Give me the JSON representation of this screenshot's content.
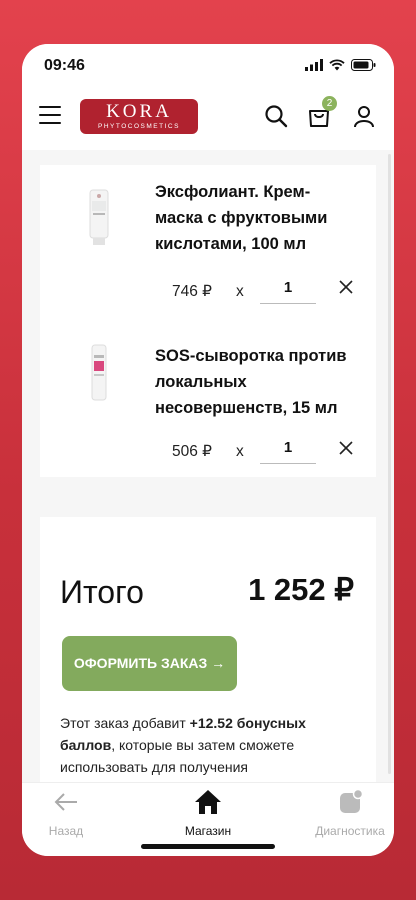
{
  "status_bar": {
    "time": "09:46"
  },
  "header": {
    "logo_text": "KORA",
    "logo_subtitle": "PHYTOCOSMETICS",
    "cart_count": "2"
  },
  "cart": {
    "items": [
      {
        "name": "Эксфолиант. Крем-маска с фруктовыми кислотами, 100 мл",
        "price": "746 ₽",
        "multiplier": "x",
        "quantity": "1"
      },
      {
        "name": "SOS-сыворотка против локальных несовершенств, 15 мл",
        "price": "506 ₽",
        "multiplier": "x",
        "quantity": "1"
      }
    ]
  },
  "summary": {
    "total_label": "Итого",
    "total_value": "1 252 ₽",
    "checkout_label": "ОФОРМИТЬ ЗАКАЗ →",
    "bonus_prefix": "Этот заказ добавит ",
    "bonus_amount": "+12.52 бонусных баллов",
    "bonus_suffix": ", которые вы затем сможете использовать для получения"
  },
  "bottom_nav": {
    "items": [
      {
        "label": "Назад",
        "icon": "arrow-left-icon",
        "active": false
      },
      {
        "label": "Магазин",
        "icon": "home-icon",
        "active": true
      },
      {
        "label": "Диагностика",
        "icon": "diagnostics-icon",
        "active": false
      }
    ]
  },
  "colors": {
    "background": "#d8363f",
    "brand": "#b0222f",
    "accent_green": "#83aa5d"
  }
}
